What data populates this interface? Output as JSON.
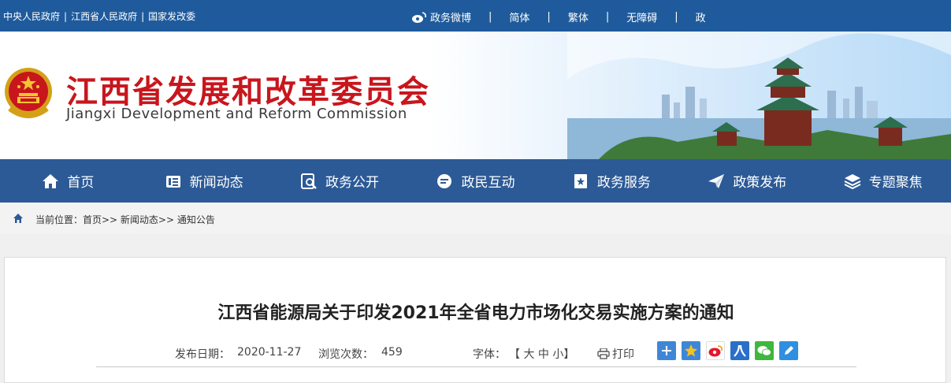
{
  "topbar": {
    "links": [
      "中央人民政府",
      "江西省人民政府",
      "国家发改委"
    ],
    "separator": "|",
    "right_items": [
      "政务微博",
      "简体",
      "繁体",
      "无障碍",
      "政"
    ]
  },
  "header": {
    "title_cn": "江西省发展和改革委员会",
    "title_en": "Jiangxi Development and Reform Commission"
  },
  "nav": {
    "items": [
      {
        "label": "首页",
        "icon": "home-icon"
      },
      {
        "label": "新闻动态",
        "icon": "news-icon"
      },
      {
        "label": "政务公开",
        "icon": "search-doc-icon"
      },
      {
        "label": "政民互动",
        "icon": "chat-icon"
      },
      {
        "label": "政务服务",
        "icon": "bookmark-star-icon"
      },
      {
        "label": "政策发布",
        "icon": "paper-plane-icon"
      },
      {
        "label": "专题聚焦",
        "icon": "layers-icon"
      }
    ]
  },
  "breadcrumb": {
    "text": "当前位置：首页>> 新闻动态>> 通知公告"
  },
  "article": {
    "title": "江西省能源局关于印发2021年全省电力市场化交易实施方案的通知",
    "publish_label": "发布日期：",
    "publish_date": "2020-11-27",
    "views_label": "浏览次数：",
    "views": "459",
    "font_label": "字体：",
    "font_sizes": "【 大 中 小】",
    "print_label": "打印"
  },
  "share": [
    "share-plus-icon",
    "qzone-icon",
    "weibo-icon",
    "renren-icon",
    "wechat-icon",
    "edit-icon"
  ],
  "colors": {
    "topbar": "#1f5b9c",
    "nav": "#2c5a96",
    "title_red": "#c8161d"
  }
}
